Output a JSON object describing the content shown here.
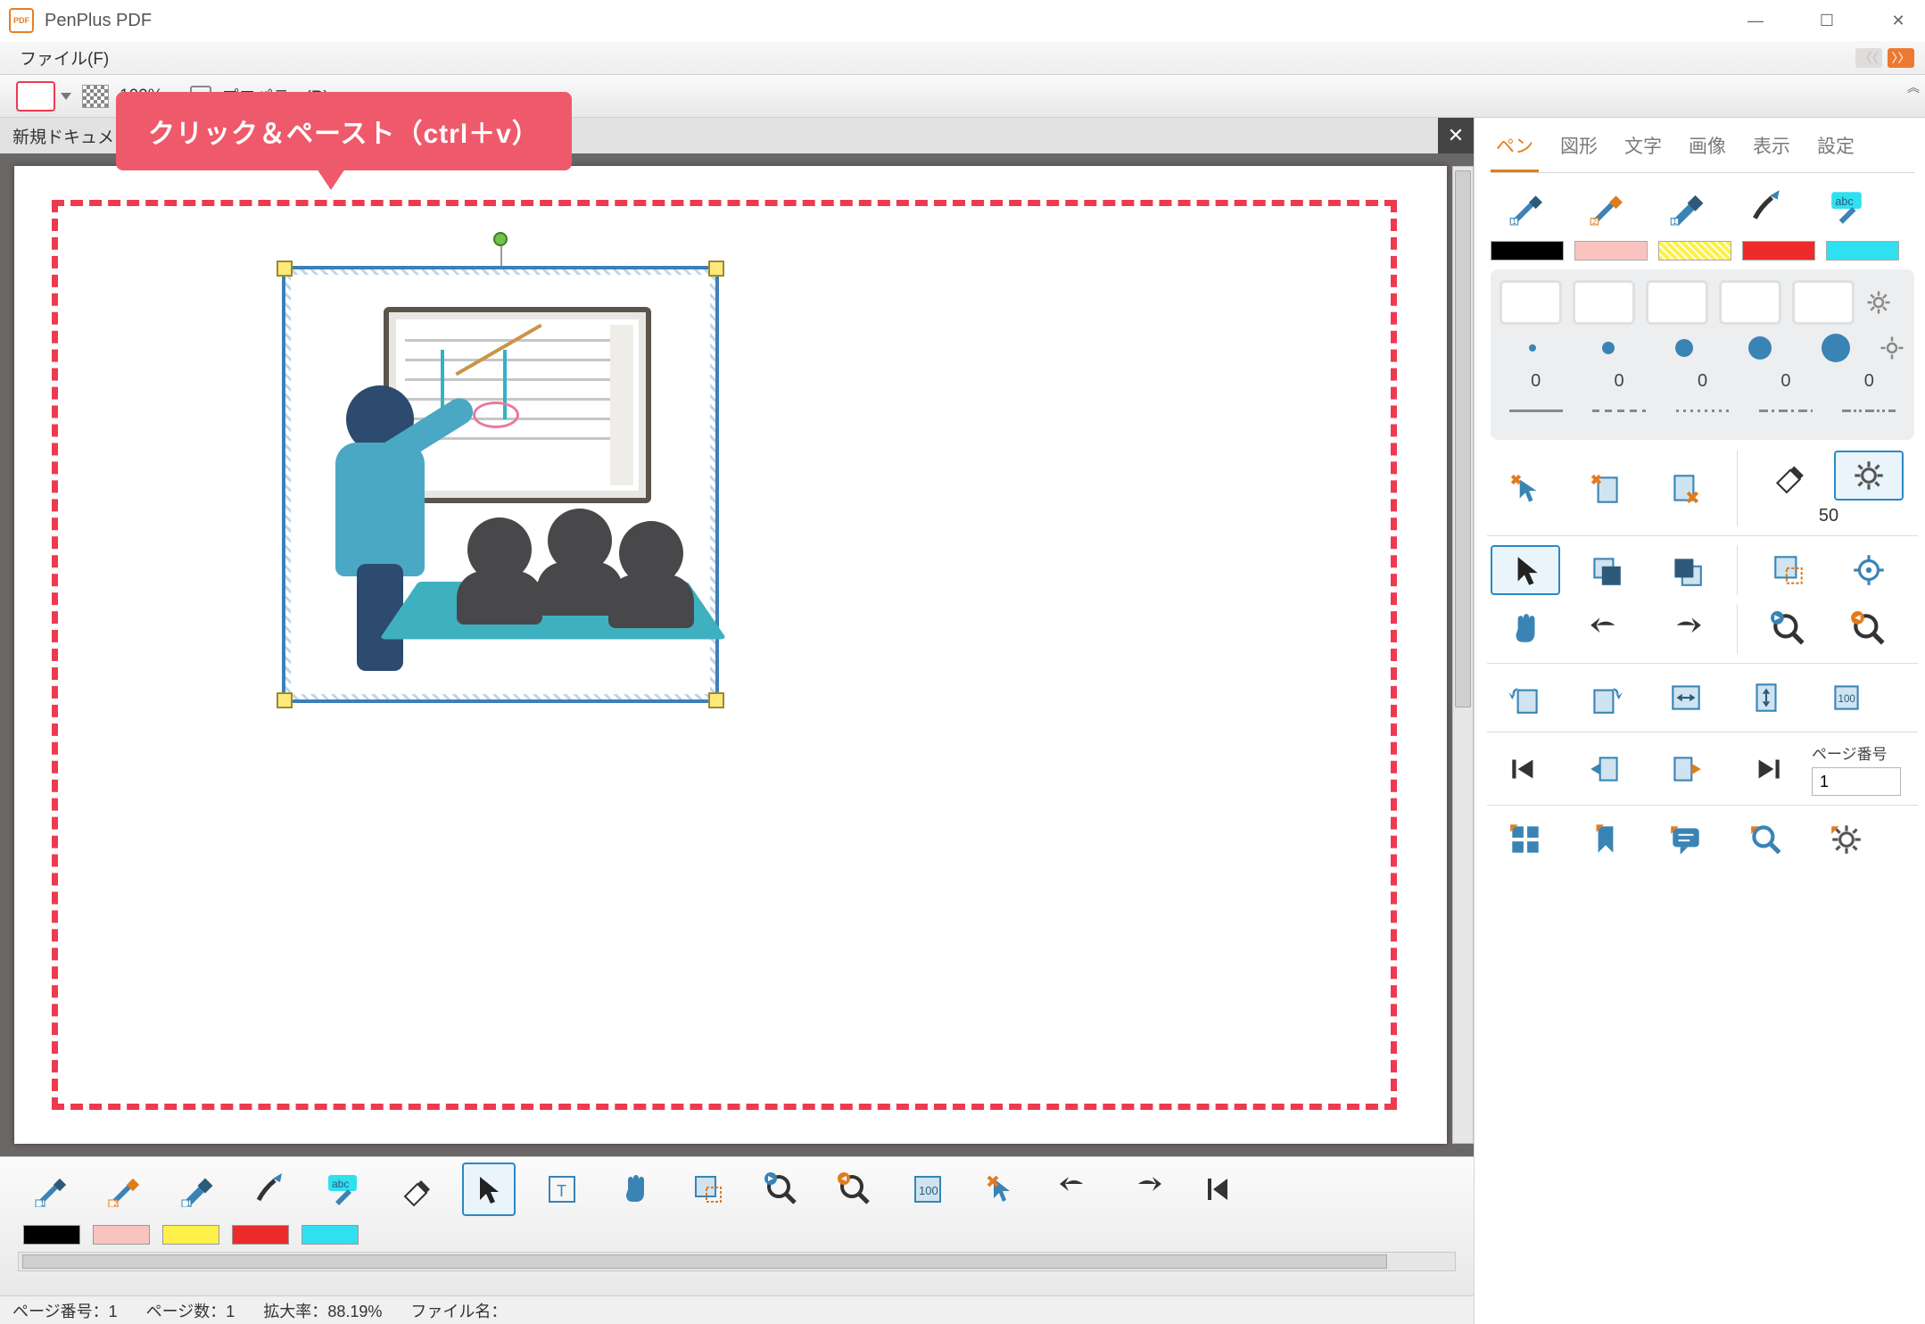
{
  "app": {
    "title": "PenPlus PDF"
  },
  "menubar": {
    "file": "ファイル(F)"
  },
  "propbar": {
    "zoom": "100%",
    "property_label": "プロパティ(R)"
  },
  "doc": {
    "tab_label": "新規ドキュメント"
  },
  "callout": {
    "text": "クリック＆ペースト（ctrl＋v）"
  },
  "statusbar": {
    "page_no_label": "ページ番号：",
    "page_no": "1",
    "page_count_label": "ページ数：",
    "page_count": "1",
    "zoom_label": "拡大率：",
    "zoom_value": "88.19%",
    "filename_label": "ファイル名："
  },
  "sidepanel": {
    "tabs": {
      "pen": "ペン",
      "shape": "図形",
      "text": "文字",
      "image": "画像",
      "view": "表示",
      "settings": "設定"
    },
    "colors": {
      "black": "#000000",
      "pink": "#f9c4c0",
      "yellow": "#fff04a",
      "red": "#ee2b2b",
      "cyan": "#2fe0f0"
    },
    "opacities": [
      "0",
      "0",
      "0",
      "0",
      "0"
    ],
    "eraser_size": "50",
    "page_number_label": "ページ番号",
    "page_number_value": "1"
  },
  "bottom_colors": {
    "black": "#000000",
    "pink": "#f9c4c0",
    "yellow": "#fff04a",
    "red": "#ee2b2b",
    "cyan": "#2fe0f0"
  }
}
